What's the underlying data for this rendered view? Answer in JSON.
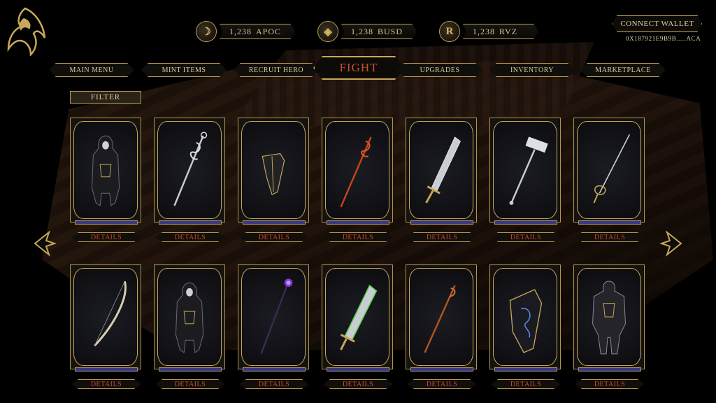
{
  "currencies": [
    {
      "icon": "apoc-coin-icon",
      "amount": "1,238",
      "symbol": "APOC"
    },
    {
      "icon": "busd-coin-icon",
      "amount": "1,238",
      "symbol": "BUSD"
    },
    {
      "icon": "rvz-coin-icon",
      "amount": "1,238",
      "symbol": "RVZ"
    }
  ],
  "wallet": {
    "button_label": "CONNECT WALLET",
    "address": "0X187921E9B9B.....ACA"
  },
  "nav": {
    "main_menu": "MAIN MENU",
    "mint_items": "MINT ITEMS",
    "recruit_hero": "RECRUIT HERO",
    "fight": "FIGHT",
    "upgrades": "UPGRADES",
    "inventory": "INVENTORY",
    "marketplace": "MARKETPLACE"
  },
  "filter_label": "FILTER",
  "details_label": "DETAILS",
  "items_row1": [
    "hooded-hero",
    "silver-twisted-staff",
    "dark-shield",
    "red-twisted-staff",
    "silver-greatsword",
    "silver-warhammer",
    "rapier"
  ],
  "items_row2": [
    "bone-bow",
    "hooded-hero",
    "purple-orb-staff",
    "green-greatsword",
    "copper-staff",
    "blue-rune-shield",
    "armored-knight"
  ],
  "colors": {
    "gold": "#c6a658",
    "fight_red": "#c8512c",
    "details_red": "#c94a2c"
  }
}
